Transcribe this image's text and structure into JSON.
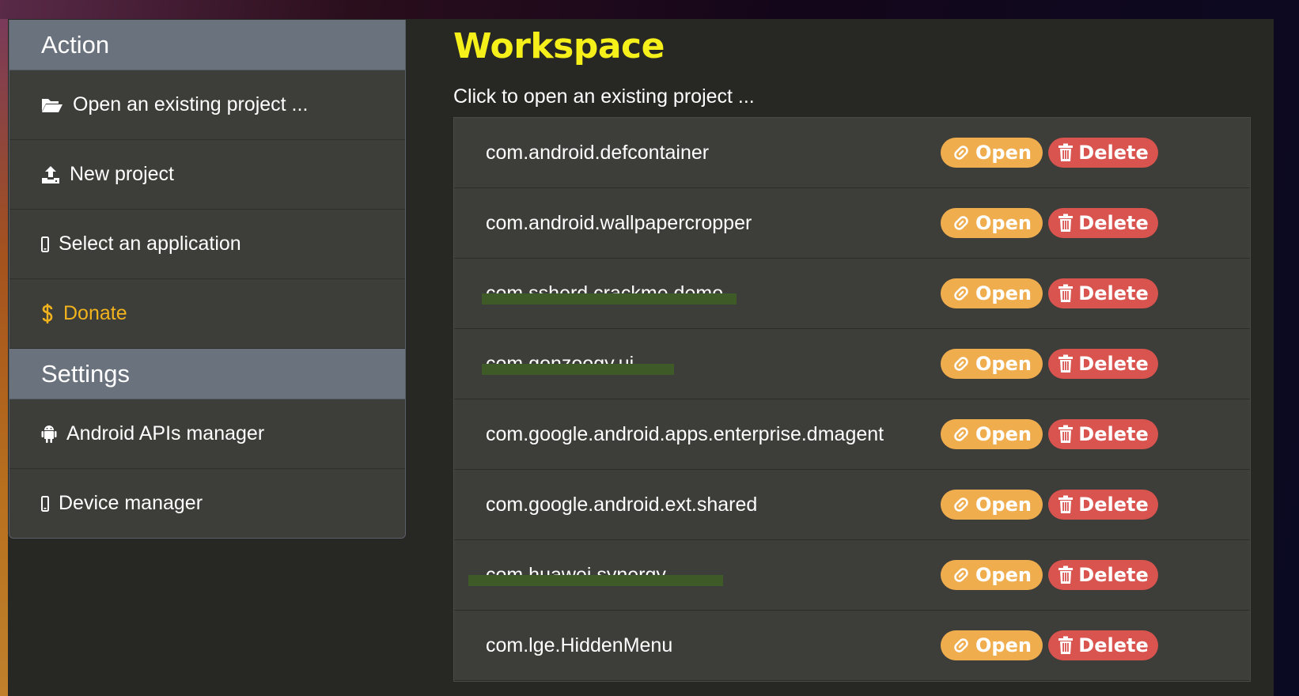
{
  "sidebar": {
    "action_header": "Action",
    "settings_header": "Settings",
    "items": [
      {
        "label": "Open an existing project ...",
        "icon": "folder-open-icon"
      },
      {
        "label": "New project",
        "icon": "upload-icon"
      },
      {
        "label": "Select an application",
        "icon": "mobile-icon"
      },
      {
        "label": "Donate",
        "icon": "dollar-icon"
      }
    ],
    "settings_items": [
      {
        "label": "Android APIs manager",
        "icon": "android-icon"
      },
      {
        "label": "Device manager",
        "icon": "mobile-icon"
      }
    ]
  },
  "main": {
    "title": "Workspace",
    "subtitle": "Click to open an existing project ...",
    "open_label": "Open",
    "delete_label": "Delete",
    "projects": [
      {
        "name": "com.android.defcontainer"
      },
      {
        "name": "com.android.wallpapercropper"
      },
      {
        "name": "com.ssherd.crackme.demo"
      },
      {
        "name": "com.gonzoogy.ui"
      },
      {
        "name": "com.google.android.apps.enterprise.dmagent"
      },
      {
        "name": "com.google.android.ext.shared"
      },
      {
        "name": "com.huawei.synergy"
      },
      {
        "name": "com.lge.HiddenMenu"
      }
    ]
  },
  "colors": {
    "accent_title": "#f6f01a",
    "donate": "#f0b31d",
    "open_button": "#f0ad4e",
    "delete_button": "#d9534f",
    "section_header": "#6a737d"
  }
}
